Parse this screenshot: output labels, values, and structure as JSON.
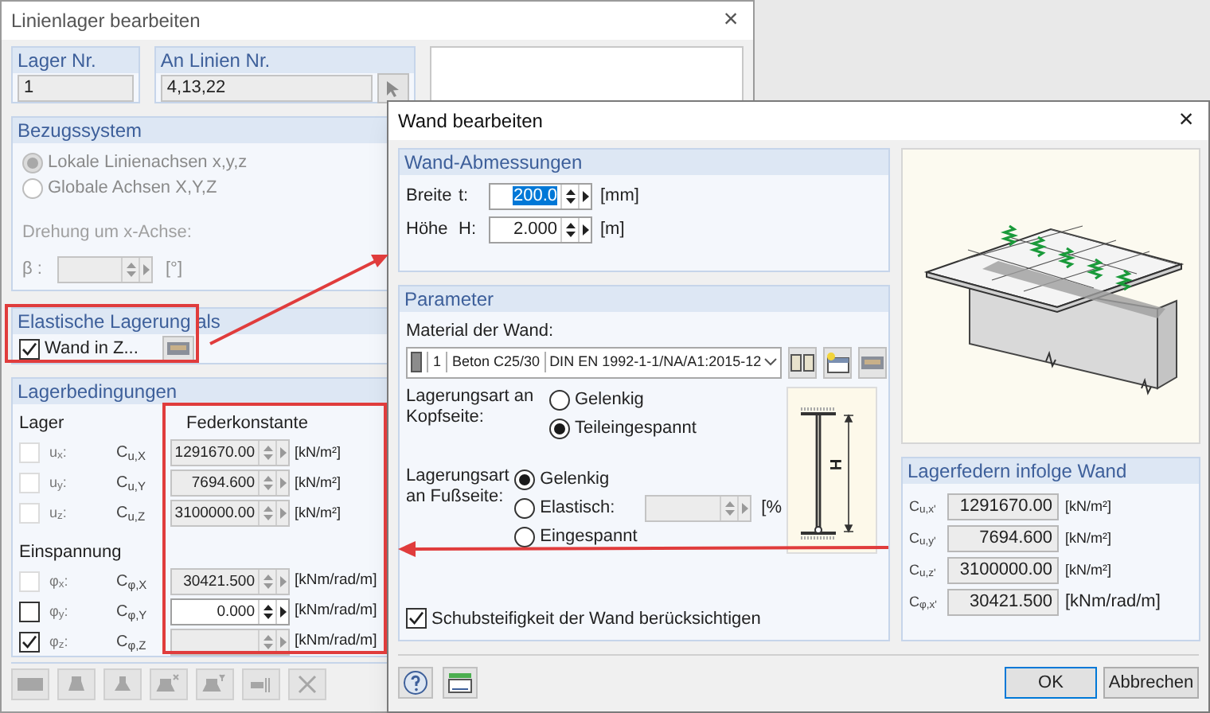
{
  "main_dialog": {
    "title": "Linienlager bearbeiten",
    "close": "×",
    "support_no": {
      "label": "Lager Nr.",
      "value": "1"
    },
    "line_no": {
      "label": "An Linien Nr.",
      "value": "4,13,22"
    },
    "reference_system": {
      "title": "Bezugssystem",
      "rotation_label": "Drehung um x-Achse:",
      "beta_label": "β :",
      "beta_unit": "[°]",
      "options": [
        {
          "label": "Lokale Linienachsen x,y,z",
          "selected": true,
          "disabled": true
        },
        {
          "label": "Globale Achsen X,Y,Z",
          "selected": false,
          "disabled": true
        }
      ]
    },
    "elastic_support": {
      "title": "Elastische Lagerung als",
      "label": "Wand in Z...",
      "checked": true
    },
    "conditions": {
      "title": "Lagerbedingungen",
      "support_label": "Lager",
      "spring_header": "Federkonstante",
      "restraint_label": "Einspannung",
      "support_rows": [
        {
          "label": "u$_{x}$:",
          "symbol": "C$_{u,X}$",
          "checked": false,
          "disabled": true,
          "editable": false,
          "value": "1291670.00",
          "unit": "[kN/m²]"
        },
        {
          "label": "u$_{y}$:",
          "symbol": "C$_{u,Y}$",
          "checked": false,
          "disabled": true,
          "editable": false,
          "value": "7694.600",
          "unit": "[kN/m²]"
        },
        {
          "label": "u$_{z}$:",
          "symbol": "C$_{u,Z}$",
          "checked": false,
          "disabled": true,
          "editable": false,
          "value": "3100000.00",
          "unit": "[kN/m²]"
        }
      ],
      "restraint_rows": [
        {
          "label": "φ$_{x}$:",
          "symbol": "C$_{φ,X}$",
          "checked": false,
          "disabled": true,
          "editable": false,
          "value": "30421.500",
          "unit": "[kNm/rad/m]"
        },
        {
          "label": "φ$_{y}$:",
          "symbol": "C$_{φ,Y}$",
          "checked": false,
          "disabled": false,
          "editable": true,
          "value": "0.000",
          "unit": "[kNm/rad/m]"
        },
        {
          "label": "φ$_{z}$:",
          "symbol": "C$_{φ,Z}$",
          "checked": true,
          "disabled": false,
          "editable": false,
          "unit": "[kNm/rad/m]"
        }
      ]
    }
  },
  "wall_dialog": {
    "title": "Wand bearbeiten",
    "close": "×",
    "dimensions": {
      "title": "Wand-Abmessungen",
      "rows": [
        {
          "label": "Breite",
          "symbol": "t:",
          "value": "200.0",
          "unit": "[mm]",
          "selected": true
        },
        {
          "label": "Höhe",
          "symbol": "H:",
          "value": "2.000",
          "unit": "[m]",
          "selected": false
        }
      ]
    },
    "parameters": {
      "title": "Parameter",
      "material_label": "Material der Wand:",
      "material": {
        "number": "1",
        "name": "Beton C25/30",
        "standard": "DIN EN 1992-1-1/NA/A1:2015-12"
      },
      "head": {
        "label": "Lagerungsart an Kopfseite:",
        "options": [
          {
            "label": "Gelenkig",
            "selected": false
          },
          {
            "label": "Teileingespannt",
            "selected": true
          }
        ]
      },
      "foot": {
        "label": "Lagerungsart an Fußseite:",
        "options": [
          {
            "label": "Gelenkig",
            "selected": true,
            "kind": "plain"
          },
          {
            "label": "Elastisch:",
            "selected": false,
            "kind": "input",
            "unit": "[%"
          },
          {
            "label": "Eingespannt",
            "selected": false,
            "kind": "plain"
          }
        ]
      },
      "diagram_label": "H",
      "shear": {
        "label": "Schubsteifigkeit der Wand berücksichtigen",
        "checked": true
      }
    },
    "springs": {
      "title": "Lagerfedern infolge Wand",
      "rows": [
        {
          "symbol": "C$_{u,x'}$",
          "value": "1291670.00",
          "unit": "[kN/m²]"
        },
        {
          "symbol": "C$_{u,y'}$",
          "value": "7694.600",
          "unit": "[kN/m²]"
        },
        {
          "symbol": "C$_{u,z'}$",
          "value": "3100000.00",
          "unit": "[kN/m²]"
        },
        {
          "symbol": "C$_{φ,x'}$",
          "value": "30421.500",
          "unit": "[kNm/rad/m]"
        }
      ]
    },
    "buttons": [
      {
        "label": "OK",
        "default": true
      },
      {
        "label": "Abbrechen",
        "default": false
      }
    ]
  }
}
